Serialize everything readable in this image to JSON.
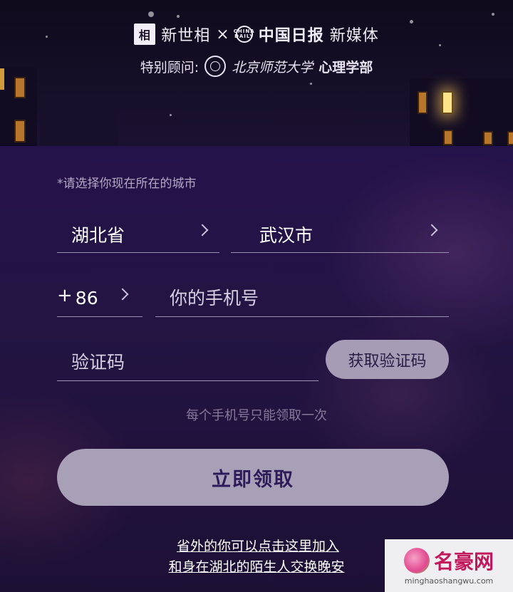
{
  "header": {
    "brand_logo_glyph": "相",
    "brand_name": "新世相",
    "separator": "×",
    "partner_logo_top": "CHINA",
    "partner_logo_bottom": "DAILY",
    "partner_name": "中国日报",
    "partner_suffix": "新媒体",
    "advisor_label": "特别顾问:",
    "advisor_school": "北京师范大学",
    "advisor_dept": "心理学部"
  },
  "form": {
    "hint": "*请选择你现在所在的城市",
    "province": "湖北省",
    "city": "武汉市",
    "country_plus": "+",
    "country_code": "86",
    "phone_placeholder": "你的手机号",
    "code_placeholder": "验证码",
    "get_code_label": "获取验证码",
    "note": "每个手机号只能领取一次",
    "claim_label": "立即领取",
    "link_line1": "省外的你可以点击这里加入",
    "link_line2": "和身在湖北的陌生人交换晚安"
  },
  "watermark": {
    "title": "名豪网",
    "url": "minghaoshangwu.com"
  },
  "colors": {
    "background": "#24124a",
    "button": "#a8a0b6",
    "button_text": "#2d1a5a",
    "window_light": "#ffe28a"
  }
}
